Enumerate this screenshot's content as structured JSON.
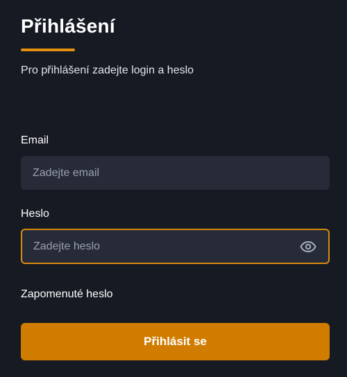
{
  "login": {
    "title": "Přihlášení",
    "subtitle": "Pro přihlášení zadejte login a heslo",
    "email": {
      "label": "Email",
      "placeholder": "Zadejte email",
      "value": ""
    },
    "password": {
      "label": "Heslo",
      "placeholder": "Zadejte heslo",
      "value": "",
      "toggle_icon": "eye-icon"
    },
    "forgot_password": "Zapomenuté heslo",
    "submit_label": "Přihlásit se"
  },
  "colors": {
    "background": "#161a23",
    "input_background": "#272b38",
    "accent": "#e58f0e",
    "button": "#d07c00",
    "focus_border": "#d98a10"
  }
}
